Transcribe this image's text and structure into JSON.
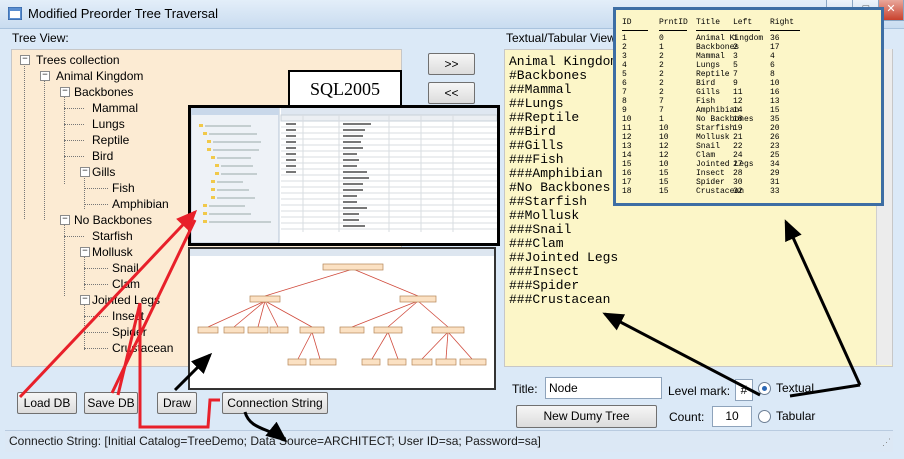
{
  "window": {
    "title": "Modified Preorder Tree Traversal",
    "minimize": "–",
    "maximize": "□",
    "close": "✕"
  },
  "tree_view": {
    "label": "Tree View:",
    "nodes": [
      "Trees collection",
      "Animal Kingdom",
      "Backbones",
      "Mammal",
      "Lungs",
      "Reptile",
      "Bird",
      "Gills",
      "Fish",
      "Amphibian",
      "No Backbones",
      "Starfish",
      "Mollusk",
      "Snail",
      "Clam",
      "Jointed Legs",
      "Insect",
      "Spider",
      "Crustacean"
    ],
    "expanders": [
      "−",
      "−",
      "−",
      "−",
      "−",
      "−",
      "−"
    ]
  },
  "arrows": {
    "right": ">>",
    "left": "<<"
  },
  "textual_view": {
    "label": "Textual/Tabular View",
    "lines": [
      "Animal Kingdom",
      "#Backbones",
      "##Mammal",
      "##Lungs",
      "##Reptile",
      "##Bird",
      "##Gills",
      "###Fish",
      "###Amphibian",
      "#No Backbones",
      "##Starfish",
      "##Mollusk",
      "###Snail",
      "###Clam",
      "##Jointed Legs",
      "###Insect",
      "###Spider",
      "###Crustacean"
    ]
  },
  "table": {
    "headers": [
      "ID",
      "PrntID",
      "Title",
      "Left",
      "Right"
    ],
    "rows": [
      [
        "1",
        "0",
        "Animal Kingdom",
        "1",
        "36"
      ],
      [
        "2",
        "1",
        "Backbones",
        "2",
        "17"
      ],
      [
        "3",
        "2",
        "Mammal",
        "3",
        "4"
      ],
      [
        "4",
        "2",
        "Lungs",
        "5",
        "6"
      ],
      [
        "5",
        "2",
        "Reptile",
        "7",
        "8"
      ],
      [
        "6",
        "2",
        "Bird",
        "9",
        "10"
      ],
      [
        "7",
        "2",
        "Gills",
        "11",
        "16"
      ],
      [
        "8",
        "7",
        "Fish",
        "12",
        "13"
      ],
      [
        "9",
        "7",
        "Amphibian",
        "14",
        "15"
      ],
      [
        "10",
        "1",
        "No Backbones",
        "18",
        "35"
      ],
      [
        "11",
        "10",
        "Starfish",
        "19",
        "20"
      ],
      [
        "12",
        "10",
        "Mollusk",
        "21",
        "26"
      ],
      [
        "13",
        "12",
        "Snail",
        "22",
        "23"
      ],
      [
        "14",
        "12",
        "Clam",
        "24",
        "25"
      ],
      [
        "15",
        "10",
        "Jointed Legs",
        "27",
        "34"
      ],
      [
        "16",
        "15",
        "Insect",
        "28",
        "29"
      ],
      [
        "17",
        "15",
        "Spider",
        "30",
        "31"
      ],
      [
        "18",
        "15",
        "Crustacean",
        "32",
        "33"
      ]
    ]
  },
  "sql_label": "SQL2005",
  "buttons": {
    "load_db": "Load DB",
    "save_db": "Save DB",
    "draw": "Draw",
    "connection_string": "Connection String",
    "new_dummy_tree": "New Dumy Tree"
  },
  "form": {
    "title_label": "Title:",
    "title_value": "Node",
    "level_mark_label": "Level mark:",
    "level_mark_value": "#",
    "count_label": "Count:",
    "count_value": "10",
    "radio_textual": "Textual",
    "radio_tabular": "Tabular"
  },
  "status_bar": {
    "text": "Connectio String: [Initial Catalog=TreeDemo; Data Source=ARCHITECT; User ID=sa; Password=sa]"
  },
  "colors": {
    "tree_bg": "#fcebd3",
    "text_bg": "#fcf6c8",
    "annotation_red": "#e8202a",
    "annotation_black": "#000000"
  }
}
